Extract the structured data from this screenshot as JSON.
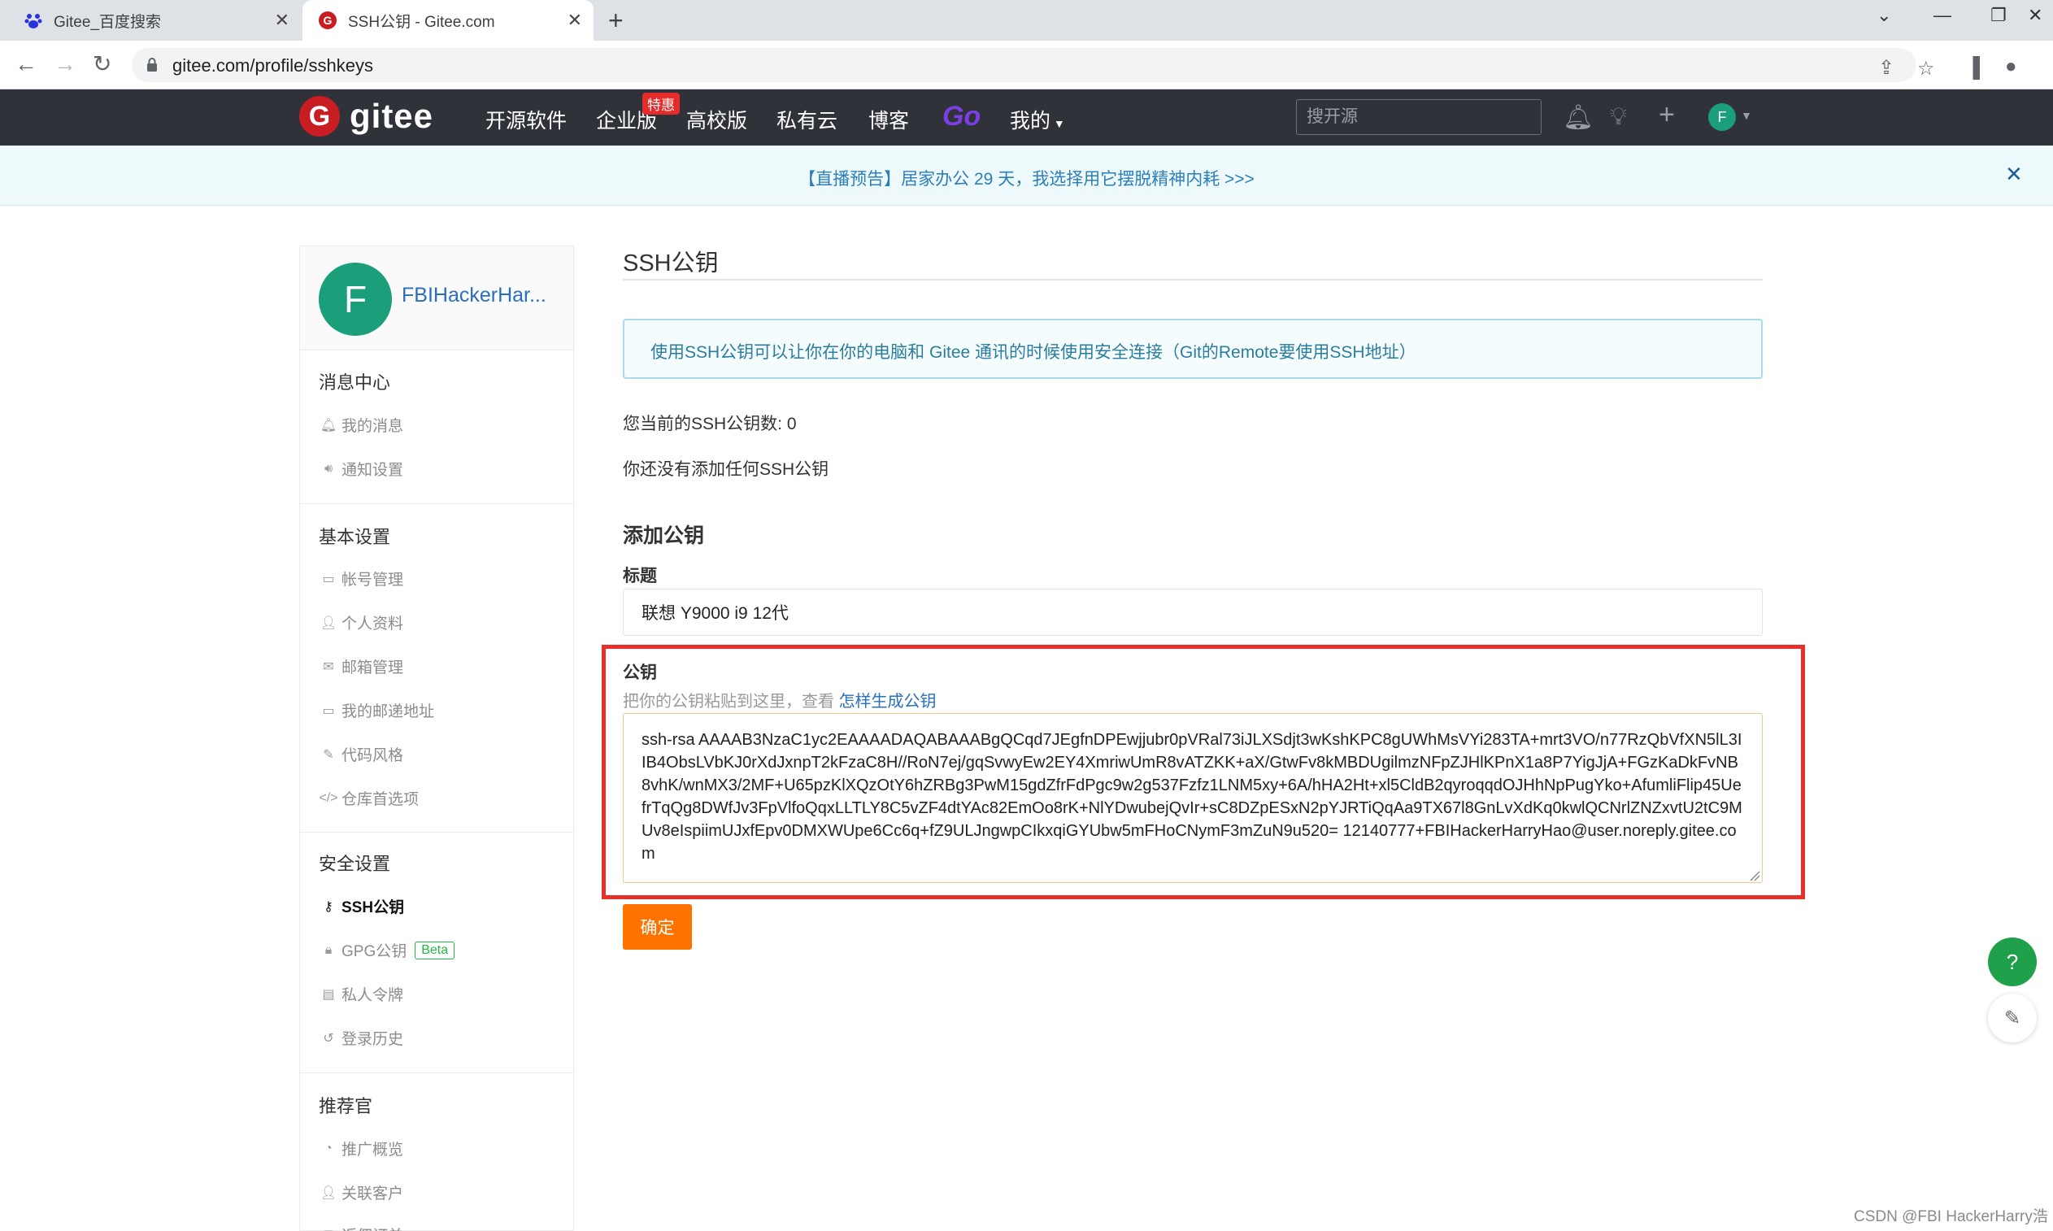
{
  "browser": {
    "tabs": [
      {
        "title": "Gitee_百度搜索",
        "icon": "baidu-icon"
      },
      {
        "title": "SSH公钥 - Gitee.com",
        "icon": "gitee-icon"
      }
    ],
    "url": "gitee.com/profile/sshkeys"
  },
  "navbar": {
    "logo_letter": "G",
    "logo_text": "gitee",
    "items": [
      "开源软件",
      "企业版",
      "高校版",
      "私有云",
      "博客"
    ],
    "hot_badge": "特惠",
    "go_label": "Go",
    "mine_label": "我的",
    "search_placeholder": "搜开源",
    "avatar_letter": "F"
  },
  "announcement": {
    "text": "【直播预告】居家办公 29 天，我选择用它摆脱精神内耗 >>>",
    "close": "✕"
  },
  "sidebar": {
    "avatar_letter": "F",
    "username": "FBIHackerHar...",
    "sections": [
      {
        "title": "消息中心",
        "items": [
          {
            "label": "我的消息",
            "icon": "bell-icon"
          },
          {
            "label": "通知设置",
            "icon": "speaker-icon"
          }
        ]
      },
      {
        "title": "基本设置",
        "items": [
          {
            "label": "帐号管理",
            "icon": "id-card-icon"
          },
          {
            "label": "个人资料",
            "icon": "user-icon"
          },
          {
            "label": "邮箱管理",
            "icon": "mail-icon"
          },
          {
            "label": "我的邮递地址",
            "icon": "address-card-icon"
          },
          {
            "label": "代码风格",
            "icon": "brush-icon"
          },
          {
            "label": "仓库首选项",
            "icon": "code-icon"
          }
        ]
      },
      {
        "title": "安全设置",
        "items": [
          {
            "label": "SSH公钥",
            "icon": "key-icon",
            "active": true
          },
          {
            "label": "GPG公钥",
            "icon": "lock-icon",
            "badge": "Beta"
          },
          {
            "label": "私人令牌",
            "icon": "token-icon"
          },
          {
            "label": "登录历史",
            "icon": "history-icon"
          }
        ]
      },
      {
        "title": "推荐官",
        "items": [
          {
            "label": "推广概览",
            "icon": "chart-icon"
          },
          {
            "label": "关联客户",
            "icon": "user-link-icon"
          },
          {
            "label": "返佣订单",
            "icon": "order-icon"
          }
        ]
      }
    ]
  },
  "main": {
    "title": "SSH公钥",
    "info": "使用SSH公钥可以让你在你的电脑和 Gitee 通讯的时候使用安全连接（Git的Remote要使用SSH地址）",
    "count_text": "您当前的SSH公钥数: 0",
    "none_text": "你还没有添加任何SSH公钥",
    "add_title": "添加公钥",
    "label_title": "标题",
    "title_value": "联想 Y9000 i9 12代",
    "label_key": "公钥",
    "key_hint": "把你的公钥粘贴到这里，查看 ",
    "key_hint_link": "怎样生成公钥",
    "key_value": "ssh-rsa AAAAB3NzaC1yc2EAAAADAQABAAABgQCqd7JEgfnDPEwjjubr0pVRal73iJLXSdjt3wKshKPC8gUWhMsVYi283TA+mrt3VO/n77RzQbVfXN5lL3IIB4ObsLVbKJ0rXdJxnpT2kFzaC8H//RoN7ej/gqSvwyEw2EY4XmriwUmR8vATZKK+aX/GtwFv8kMBDUgilmzNFpZJHlKPnX1a8P7YigJjA+FGzKaDkFvNB8vhK/wnMX3/2MF+U65pzKlXQzOtY6hZRBg3PwM15gdZfrFdPgc9w2g537Fzfz1LNM5xy+6A/hHA2Ht+xl5CldB2qyroqqdOJHhNpPugYko+AfumliFlip45UefrTqQg8DWfJv3FpVlfoQqxLLTLY8C5vZF4dtYAc82EmOo8rK+NlYDwubejQvIr+sC8DZpESxN2pYJRTiQqAa9TX67l8GnLvXdKq0kwlQCNrlZNZxvtU2tC9MUv8eIspiimUJxfEpv0DMXWUpe6Cc6q+fZ9ULJngwpCIkxqiGYUbw5mFHoCNymF3mZuN9u520= 12140777+FBIHackerHarryHao@user.noreply.gitee.com",
    "confirm": "确定"
  },
  "floating": {
    "help": "?",
    "watermark": "CSDN @FBI HackerHarry浩"
  },
  "colors": {
    "nav_bg": "#2f3238",
    "accent_orange": "#fe7300",
    "highlight_red": "#e8302b",
    "link_blue": "#2a6fbb",
    "avatar_green": "#1a9f7a"
  }
}
